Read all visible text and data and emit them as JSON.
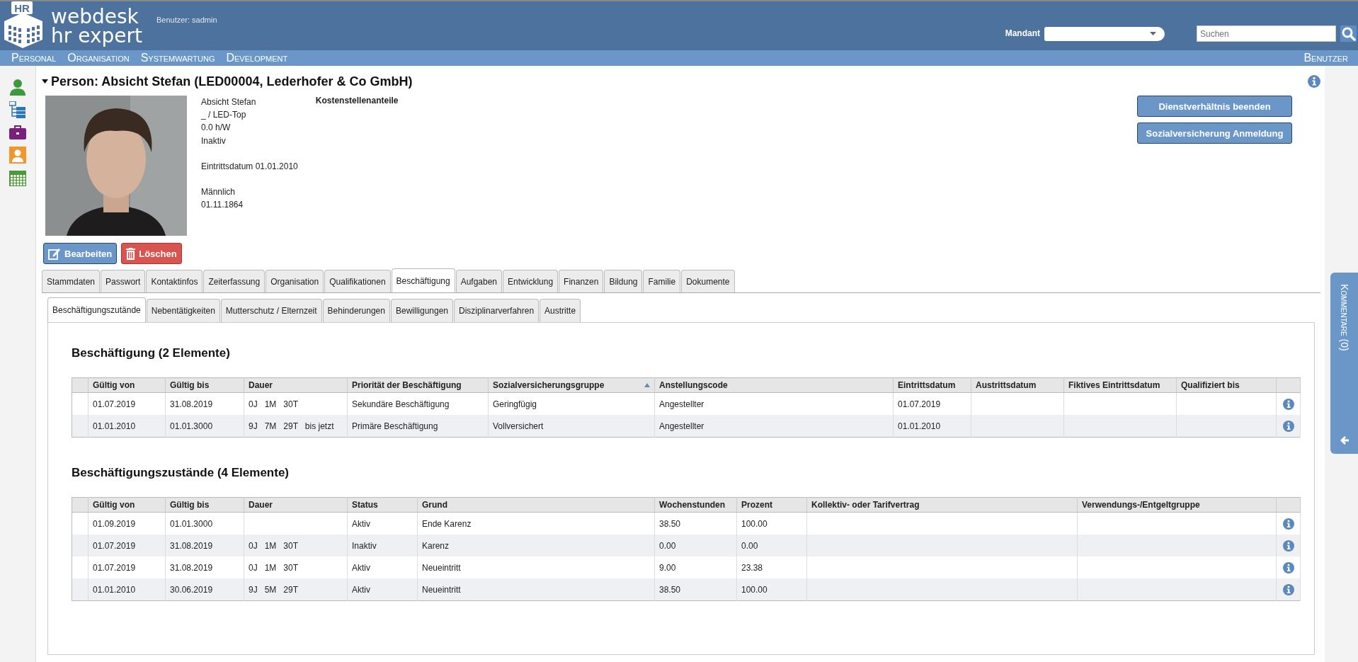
{
  "header": {
    "logo_badge": "HR",
    "logo_line1": "webdesk",
    "logo_line2": "hr expert",
    "user_label": "Benutzer: sadmin",
    "mandant_label": "Mandant",
    "search": {
      "placeholder": "Suchen"
    }
  },
  "menu": {
    "items": [
      "Personal",
      "Organisation",
      "Systemwartung",
      "Development"
    ],
    "right": "Benutzer"
  },
  "sidebar": {
    "items": [
      {
        "kind": "person"
      },
      {
        "kind": "tree"
      },
      {
        "kind": "briefcase"
      },
      {
        "kind": "contact"
      },
      {
        "kind": "calendar"
      }
    ]
  },
  "person": {
    "title": "Person: Absicht Stefan (LED00004, Lederhofer & Co GmbH)",
    "photo": {
      "kind": "picture"
    },
    "details": [
      [
        "Absicht Stefan",
        "_ / LED-Top",
        "0.0 h/W",
        "Inaktiv"
      ],
      [
        "Eintrittsdatum 01.01.2010"
      ],
      [
        "Männlich",
        "01.11.1864"
      ]
    ],
    "cost_heading": "Kostenstellenanteile",
    "edit_button": "Bearbeiten",
    "delete_button": "Löschen",
    "actions": [
      "Dienstverhältnis beenden",
      "Sozialversicherung Anmeldung"
    ]
  },
  "tabs": [
    {
      "label": "Stammdaten",
      "selected": false
    },
    {
      "label": "Passwort",
      "selected": false
    },
    {
      "label": "Kontaktinfos",
      "selected": false
    },
    {
      "label": "Zeiterfassung",
      "selected": false
    },
    {
      "label": "Organisation",
      "selected": false
    },
    {
      "label": "Qualifikationen",
      "selected": false
    },
    {
      "label": "Beschäftigung",
      "selected": true
    },
    {
      "label": "Aufgaben",
      "selected": false
    },
    {
      "label": "Entwicklung",
      "selected": false
    },
    {
      "label": "Finanzen",
      "selected": false
    },
    {
      "label": "Bildung",
      "selected": false
    },
    {
      "label": "Familie",
      "selected": false
    },
    {
      "label": "Dokumente",
      "selected": false
    }
  ],
  "subtabs": [
    {
      "label": "Beschäftigungszutände",
      "selected": true
    },
    {
      "label": "Nebentätigkeiten",
      "selected": false
    },
    {
      "label": "Mutterschutz / Elternzeit",
      "selected": false
    },
    {
      "label": "Behinderungen",
      "selected": false
    },
    {
      "label": "Bewilligungen",
      "selected": false
    },
    {
      "label": "Disziplinarverfahren",
      "selected": false
    },
    {
      "label": "Austritte",
      "selected": false
    }
  ],
  "tables": [
    {
      "title": "Beschäftigung (2 Elemente)",
      "columns": [
        {
          "label": "Gültig von",
          "sorted": false
        },
        {
          "label": "Gültig bis",
          "sorted": false
        },
        {
          "label": "Dauer",
          "sorted": false
        },
        {
          "label": "Priorität der Beschäftigung",
          "sorted": false
        },
        {
          "label": "Sozialversicherungsgruppe",
          "sorted": true
        },
        {
          "label": "Anstellungscode",
          "sorted": false
        },
        {
          "label": "Eintrittsdatum",
          "sorted": false
        },
        {
          "label": "Austrittsdatum",
          "sorted": false
        },
        {
          "label": "Fiktives Eintrittsdatum",
          "sorted": false
        },
        {
          "label": "Qualifiziert bis",
          "sorted": false
        }
      ],
      "rows": [
        [
          "01.07.2019",
          "31.08.2019",
          "0J   1M   30T",
          "Sekundäre Beschäftigung",
          "Geringfügig",
          "Angestellter",
          "01.07.2019",
          "",
          "",
          ""
        ],
        [
          "01.01.2010",
          "01.01.3000",
          "9J   7M   29T   bis jetzt",
          "Primäre Beschäftigung",
          "Vollversichert",
          "Angestellter",
          "01.01.2010",
          "",
          "",
          ""
        ]
      ]
    },
    {
      "title": "Beschäftigungszustände (4 Elemente)",
      "columns": [
        {
          "label": "Gültig von",
          "sorted": false
        },
        {
          "label": "Gültig bis",
          "sorted": false
        },
        {
          "label": "Dauer",
          "sorted": false
        },
        {
          "label": "Status",
          "sorted": false
        },
        {
          "label": "Grund",
          "sorted": false
        },
        {
          "label": "Wochenstunden",
          "sorted": false
        },
        {
          "label": "Prozent",
          "sorted": false
        },
        {
          "label": "Kollektiv- oder Tarifvertrag",
          "sorted": false
        },
        {
          "label": "Verwendungs-/Entgeltgruppe",
          "sorted": false
        }
      ],
      "rows": [
        [
          "01.09.2019",
          "01.01.3000",
          "",
          "Aktiv",
          "Ende Karenz",
          "38.50",
          "100.00",
          "",
          ""
        ],
        [
          "01.07.2019",
          "31.08.2019",
          "0J   1M   30T",
          "Inaktiv",
          "Karenz",
          "0.00",
          "0.00",
          "",
          ""
        ],
        [
          "01.07.2019",
          "31.08.2019",
          "0J   1M   30T",
          "Aktiv",
          "Neueintritt",
          "9.00",
          "23.38",
          "",
          ""
        ],
        [
          "01.01.2010",
          "30.06.2019",
          "9J   5M   29T",
          "Aktiv",
          "Neueintritt",
          "38.50",
          "100.00",
          "",
          ""
        ]
      ]
    }
  ],
  "comments_tab": "Kommentare (0)"
}
